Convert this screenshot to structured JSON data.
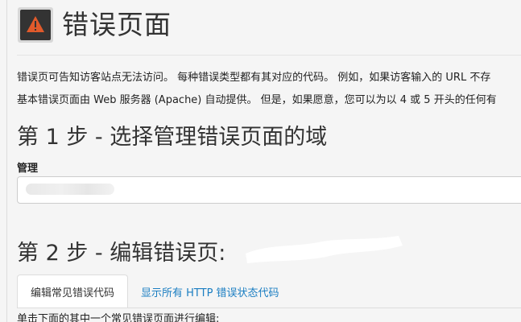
{
  "header": {
    "icon": "warning-icon",
    "title": "错误页面"
  },
  "description": {
    "line1": "错误页可告知访客站点无法访问。 每种错误类型都有其对应的代码。 例如，如果访客输入的 URL 不存",
    "line2": "基本错误页面由 Web 服务器 (Apache) 自动提供。 但是，如果愿意，您可以为以 4 或 5 开头的任何有"
  },
  "step1": {
    "title": "第 1 步 - 选择管理错误页面的域",
    "field_label": "管理",
    "selected_domain": ""
  },
  "step2": {
    "title": "第 2 步 - 编辑错误页:",
    "tabs": [
      {
        "label": "编辑常见错误代码",
        "active": true
      },
      {
        "label": "显示所有 HTTP 错误状态代码",
        "active": false
      }
    ],
    "instruction": "单击下面的其中一个常见错误页面进行编辑:"
  },
  "colors": {
    "icon_bg": "#333333",
    "icon_warning": "#e05a2b",
    "link": "#1b7ec2"
  }
}
